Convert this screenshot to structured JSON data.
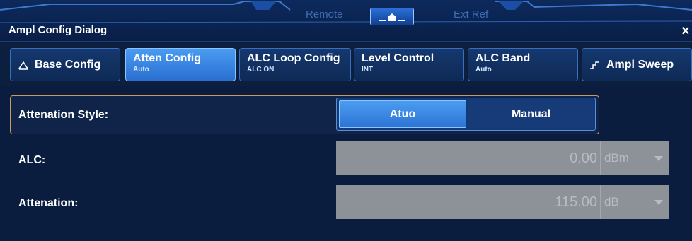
{
  "status_bar": {
    "remote_label": "Remote",
    "ext_ref_label": "Ext Ref",
    "home_icon": "home-icon"
  },
  "dialog": {
    "title": "Ampl Config Dialog",
    "close_label": "×"
  },
  "tabs": [
    {
      "label": "Base Config",
      "sub": "",
      "icon": "triangle-icon",
      "active": false
    },
    {
      "label": "Atten Config",
      "sub": "Auto",
      "active": true
    },
    {
      "label": "ALC Loop Config",
      "sub": "ALC ON",
      "active": false
    },
    {
      "label": "Level Control",
      "sub": "INT",
      "active": false
    },
    {
      "label": "ALC Band",
      "sub": "Auto",
      "active": false
    },
    {
      "label": "Ampl Sweep",
      "sub": "",
      "icon": "sweep-icon",
      "active": false
    }
  ],
  "form": {
    "attenuation_style": {
      "label": "Attenation Style:",
      "options": [
        "Atuo",
        "Manual"
      ],
      "selected": "Atuo"
    },
    "alc": {
      "label": "ALC:",
      "value": "0.00",
      "unit": "dBm"
    },
    "attenuation": {
      "label": "Attenation:",
      "value": "115.00",
      "unit": "dB"
    }
  },
  "colors": {
    "background": "#0b1a33",
    "accent": "#2d73d5",
    "highlight_border": "#c89a6a",
    "disabled_field": "#8d9198"
  }
}
